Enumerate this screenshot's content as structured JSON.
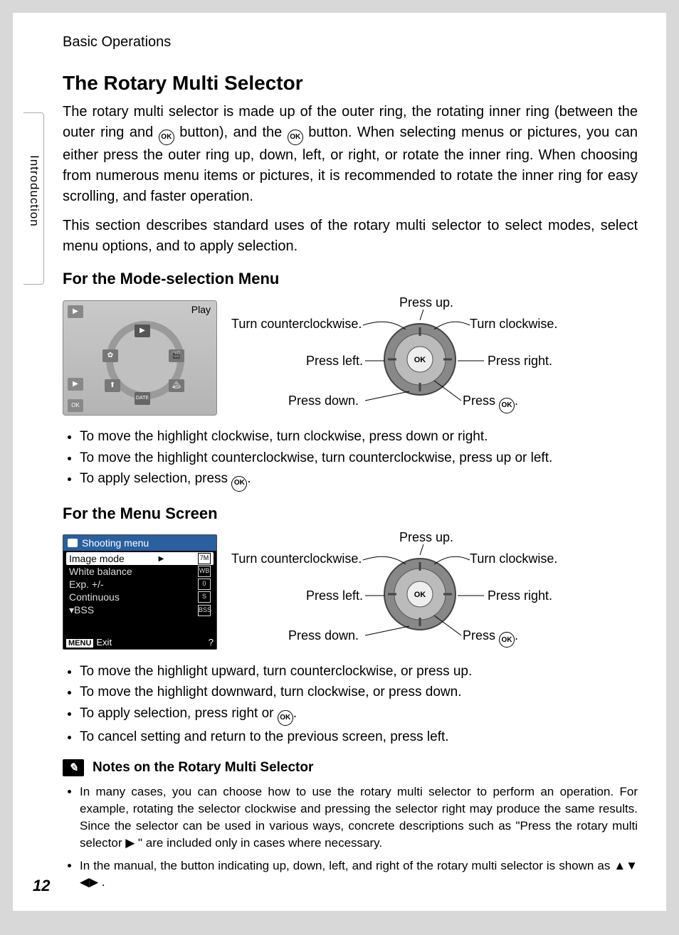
{
  "page_number": "12",
  "breadcrumb": "Basic Operations",
  "side_tab": "Introduction",
  "title": "The Rotary Multi Selector",
  "intro_p1a": "The rotary multi selector is made up of the outer ring, the rotating inner ring (between the outer ring and ",
  "intro_p1b": " button), and the ",
  "intro_p1c": " button. When selecting menus or pictures, you can either press the outer ring up, down, left, or right, or rotate the inner ring. When choosing from numerous menu items or pictures, it is recommended to rotate the inner ring for easy scrolling, and faster operation.",
  "intro_p2": "This section describes standard uses of the rotary multi selector to select modes, select menu options, and to apply selection.",
  "mode_heading": "For the Mode-selection Menu",
  "mode_screen_label": "Play",
  "dial_labels": {
    "press_up": "Press up.",
    "turn_ccw": "Turn counterclockwise.",
    "turn_cw": "Turn clockwise.",
    "press_left": "Press left.",
    "press_right": "Press right.",
    "press_down": "Press down.",
    "press_ok": "Press ",
    "ok_suffix": "."
  },
  "mode_bullets": [
    "To move the highlight clockwise, turn clockwise, press down or right.",
    "To move the highlight counterclockwise, turn counterclockwise, press up or left.",
    "To apply selection, press "
  ],
  "menu_heading": "For the Menu Screen",
  "shoot_header": "Shooting menu",
  "shoot_items": [
    "Image mode",
    "White balance",
    "Exp. +/-",
    "Continuous",
    "BSS"
  ],
  "shoot_exit": "Exit",
  "shoot_menu_tag": "MENU",
  "menu_bullets_a": "To move the highlight upward, turn counterclockwise, or press up.",
  "menu_bullets_b": "To move the highlight downward, turn clockwise, or press down.",
  "menu_bullets_c": "To apply selection, press right or ",
  "menu_bullets_d": "To cancel setting and return to the previous screen, press left.",
  "notes_heading": "Notes on the Rotary Multi Selector",
  "notes": {
    "n1a": "In many cases, you can choose how to use the rotary multi selector to perform an operation. For example, rotating the selector clockwise and pressing the selector right may produce the same results. Since the selector can be used in various ways, concrete descriptions such as \"Press the rotary multi selector ",
    "n1b": " \" are included only in cases where necessary.",
    "n2a": "In the manual, the button indicating up, down, left, and right of the rotary multi selector is shown as ",
    "n2b": " ."
  }
}
